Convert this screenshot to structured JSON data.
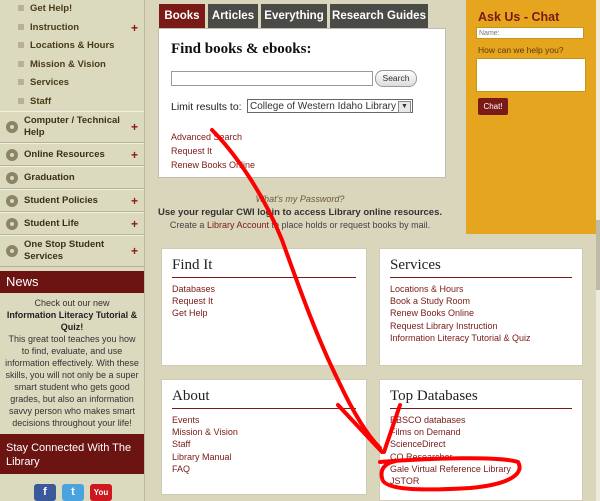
{
  "sidebar": {
    "subitems": [
      {
        "label": "Get Help!",
        "plus": false
      },
      {
        "label": "Instruction",
        "plus": true
      },
      {
        "label": "Locations & Hours",
        "plus": false
      },
      {
        "label": "Mission & Vision",
        "plus": false
      },
      {
        "label": "Services",
        "plus": false
      },
      {
        "label": "Staff",
        "plus": false
      }
    ],
    "items": [
      {
        "label": "Computer / Technical Help",
        "plus": true
      },
      {
        "label": "Online Resources",
        "plus": true
      },
      {
        "label": "Graduation",
        "plus": false
      },
      {
        "label": "Student Policies",
        "plus": true
      },
      {
        "label": "Student Life",
        "plus": true
      },
      {
        "label": "One Stop Student Services",
        "plus": true
      }
    ],
    "plus_symbol": "+"
  },
  "news": {
    "header": "News",
    "line1": "Check out our new",
    "title": "Information Literacy Tutorial & Quiz!",
    "body": "This great tool teaches you how to find, evaluate, and use information effectively. With these skills, you will not only be a super smart student who gets good grades, but also an information savvy person who makes smart decisions throughout your life!"
  },
  "stay": "Stay Connected With The Library",
  "social": [
    {
      "icon": "facebook-icon",
      "glyph": "f",
      "color": "#3b5998"
    },
    {
      "icon": "twitter-icon",
      "glyph": "t",
      "color": "#4aa3df"
    },
    {
      "icon": "youtube-icon",
      "glyph": "You",
      "color": "#cc181e"
    }
  ],
  "tabs": [
    "Books",
    "Articles",
    "Everything",
    "Research Guides"
  ],
  "search": {
    "title": "Find books & ebooks:",
    "input_value": "",
    "button": "Search",
    "limit_label": "Limit results to:",
    "limit_value": "College of Western Idaho Library",
    "links": [
      "Advanced Search",
      "Request It",
      "Renew Books Online"
    ]
  },
  "info": {
    "password": "What's my Password?",
    "bold": "Use your regular CWI login to access Library online resources.",
    "create_pre": "Create a ",
    "create_link": "Library Account",
    "create_post": " to place holds or request books by mail."
  },
  "boxes": {
    "findit": {
      "title": "Find It",
      "links": [
        "Databases",
        "Request It",
        "Get Help"
      ]
    },
    "services": {
      "title": "Services",
      "links": [
        "Locations & Hours",
        "Book a Study Room",
        "Renew Books Online",
        "Request Library Instruction",
        "Information Literacy Tutorial & Quiz"
      ]
    },
    "about": {
      "title": "About",
      "links": [
        "Events",
        "Mission & Vision",
        "Staff",
        "Library Manual",
        "FAQ"
      ]
    },
    "topdb": {
      "title": "Top Databases",
      "links": [
        "EBSCO databases",
        "Films on Demand",
        "ScienceDirect",
        "CQ Researcher",
        "Gale Virtual Reference Library",
        "JSTOR"
      ]
    }
  },
  "chat": {
    "title": "Ask Us - Chat",
    "name_placeholder": "Name:",
    "question": "How can we help you?",
    "button": "Chat!"
  },
  "annotation_color": "#ff0000"
}
